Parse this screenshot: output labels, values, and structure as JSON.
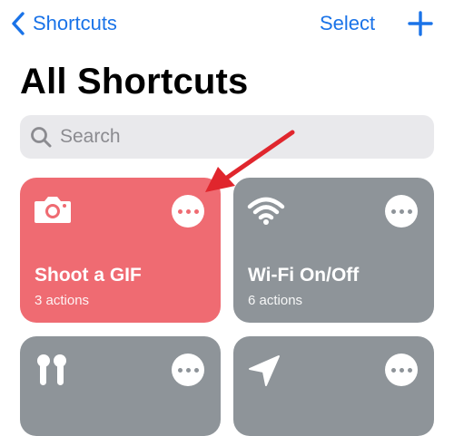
{
  "nav": {
    "back_label": "Shortcuts",
    "select_label": "Select",
    "back_icon": "chevron-left-icon",
    "add_icon": "plus-icon",
    "accent_color": "#1a73e8"
  },
  "title": "All Shortcuts",
  "search": {
    "placeholder": "Search",
    "icon": "magnifier-icon"
  },
  "tiles": [
    {
      "title": "Shoot a GIF",
      "subtitle": "3 actions",
      "icon": "camera-icon",
      "color": "#ef6b72"
    },
    {
      "title": "Wi-Fi On/Off",
      "subtitle": "6 actions",
      "icon": "wifi-icon",
      "color": "#8e9499"
    },
    {
      "title": "",
      "subtitle": "",
      "icon": "airpods-icon",
      "color": "#8e9499"
    },
    {
      "title": "",
      "subtitle": "",
      "icon": "location-arrow-icon",
      "color": "#8e9499"
    }
  ],
  "annotation": {
    "icon": "red-arrow-annotation",
    "color": "#e0262d"
  }
}
